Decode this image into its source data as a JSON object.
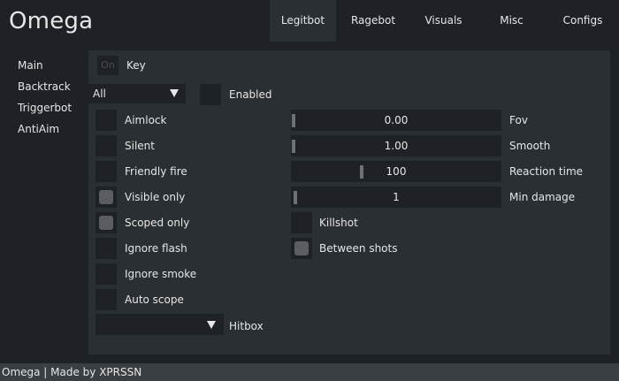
{
  "app": {
    "title": "Omega"
  },
  "tabs": [
    {
      "label": "Legitbot",
      "active": true
    },
    {
      "label": "Ragebot",
      "active": false
    },
    {
      "label": "Visuals",
      "active": false
    },
    {
      "label": "Misc",
      "active": false
    },
    {
      "label": "Configs",
      "active": false
    }
  ],
  "sidebar": {
    "items": [
      {
        "label": "Main"
      },
      {
        "label": "Backtrack"
      },
      {
        "label": "Triggerbot"
      },
      {
        "label": "AntiAim"
      }
    ]
  },
  "key": {
    "button_text": "On",
    "label": "Key"
  },
  "weapon_dropdown": {
    "value": "All"
  },
  "enabled": {
    "label": "Enabled",
    "checked": false
  },
  "options_left": [
    {
      "label": "Aimlock",
      "checked": false
    },
    {
      "label": "Silent",
      "checked": false
    },
    {
      "label": "Friendly fire",
      "checked": false
    },
    {
      "label": "Visible only",
      "checked": true
    },
    {
      "label": "Scoped only",
      "checked": true
    },
    {
      "label": "Ignore flash",
      "checked": false
    },
    {
      "label": "Ignore smoke",
      "checked": false
    },
    {
      "label": "Auto scope",
      "checked": false
    }
  ],
  "sliders": [
    {
      "label": "Fov",
      "value": "0.00",
      "fraction": 0.0
    },
    {
      "label": "Smooth",
      "value": "1.00",
      "fraction": 0.0
    },
    {
      "label": "Reaction time",
      "value": "100",
      "fraction": 0.33
    },
    {
      "label": "Min damage",
      "value": "1",
      "fraction": 0.01
    }
  ],
  "options_right": [
    {
      "label": "Killshot",
      "checked": false
    },
    {
      "label": "Between shots",
      "checked": true
    }
  ],
  "hitbox": {
    "label": "Hitbox",
    "value": ""
  },
  "footer": {
    "text": "Omega | Made by XPRSSN"
  },
  "colors": {
    "background": "#1e2125",
    "panel": "#2a2f33",
    "control": "#1e2226",
    "text": "#e6e6e6",
    "checked_fill": "#5a5e62",
    "footer": "#3a3f43"
  }
}
